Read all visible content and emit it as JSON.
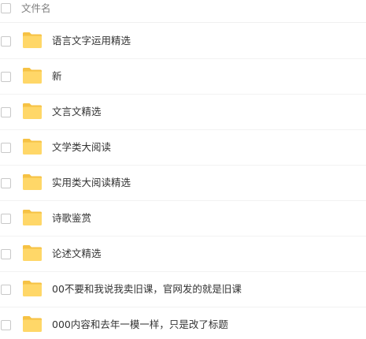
{
  "header": {
    "column_label": "文件名"
  },
  "files": [
    {
      "name": "语言文字运用精选",
      "icon": "folder-icon"
    },
    {
      "name": "新",
      "icon": "folder-icon"
    },
    {
      "name": "文言文精选",
      "icon": "folder-icon"
    },
    {
      "name": "文学类大阅读",
      "icon": "folder-icon"
    },
    {
      "name": "实用类大阅读精选",
      "icon": "folder-icon"
    },
    {
      "name": "诗歌鉴赏",
      "icon": "folder-icon"
    },
    {
      "name": "论述文精选",
      "icon": "folder-icon"
    },
    {
      "name": "00不要和我说我卖旧课，官网发的就是旧课",
      "icon": "folder-icon"
    },
    {
      "name": "000内容和去年一模一样，只是改了标题",
      "icon": "folder-icon"
    }
  ],
  "colors": {
    "folder_body": "#ffd768",
    "folder_tab": "#f6c244",
    "text": "#333333",
    "header_text": "#7d7d7d",
    "checkbox_border": "#c8c8c8",
    "divider": "#f2f2f2"
  }
}
